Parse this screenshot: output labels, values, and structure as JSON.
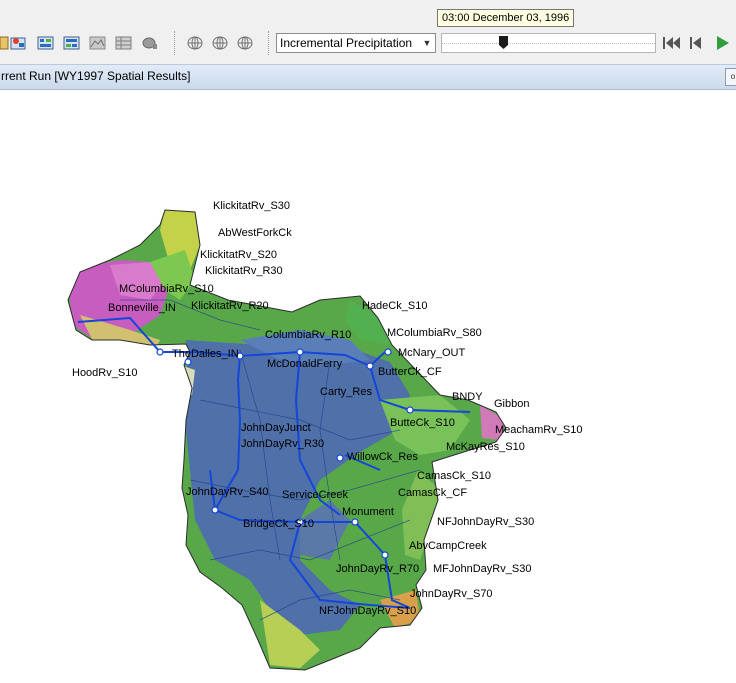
{
  "toolbar": {
    "tools": [
      {
        "icon": "grid-tool-icon"
      },
      {
        "icon": "compute-run-icon"
      },
      {
        "icon": "compute-run-alt-icon"
      },
      {
        "icon": "compute-current-icon"
      },
      {
        "icon": "terrain-icon"
      },
      {
        "icon": "table-icon"
      },
      {
        "icon": "bucket-icon"
      },
      {
        "icon": "globe-grid-icon"
      },
      {
        "icon": "globe-grid-icon"
      },
      {
        "icon": "globe-grid-icon"
      }
    ],
    "parameter_select": "Incremental Precipitation",
    "time_tooltip": "03:00 December 03, 1996",
    "time_slider_position": 0.28,
    "controls": [
      "rewind-start-icon",
      "step-back-icon",
      "play-icon"
    ]
  },
  "window": {
    "title": "rrent Run [WY1997 Spatial Results]",
    "corner_button": "o"
  },
  "map": {
    "labels": [
      "KlickitatRv_S30",
      "AbWestForkCk",
      "KlickitatRv_S20",
      "KlickitatRv_R30",
      "MColumbiaRv_S10",
      "Bonneville_IN",
      "KlickitatRv_R20",
      "HadeCk_S10",
      "ColumbiaRv_R10",
      "MColumbiaRv_S80",
      "McNary_OUT",
      "TheDalles_IN",
      "McDonaldFerry",
      "ButterCk_CF",
      "HoodRv_S10",
      "Carty_Res",
      "BNDY",
      "Gibbon",
      "ButteCk_S10",
      "MeachamRv_S10",
      "JohnDayJunct",
      "JohnDayRv_R30",
      "McKayRes_S10",
      "WillowCk_Res",
      "CamasCk_S10",
      "CamasCk_CF",
      "JohnDayRv_S40",
      "ServiceCreek",
      "Monument",
      "NFJohnDayRv_S30",
      "BridgeCk_S10",
      "AbvCampCreek",
      "JohnDayRv_R70",
      "MFJohnDayRv_S30",
      "JohnDayRv_S70",
      "NFJohnDayRv_S10"
    ]
  }
}
